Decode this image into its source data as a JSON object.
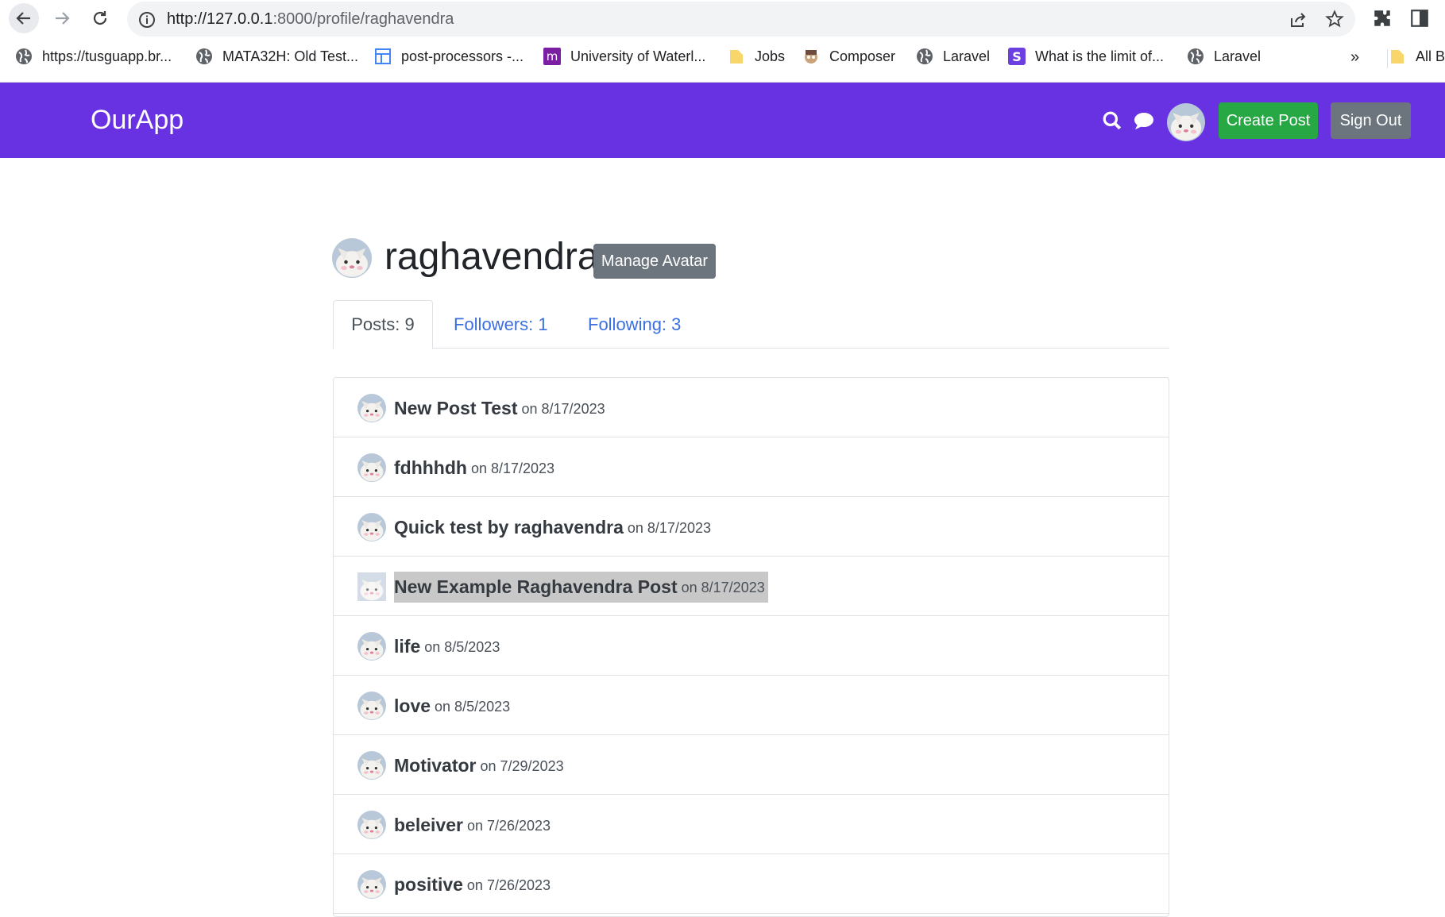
{
  "browser": {
    "url_host": "http://127.0.0.1",
    "url_rest": ":8000/profile/raghavendra",
    "bookmarks": [
      {
        "label": "https://tusguapp.br...",
        "icon": "globe-icon"
      },
      {
        "label": "MATA32H: Old Test...",
        "icon": "globe-icon"
      },
      {
        "label": "post-processors -...",
        "icon": "doc-icon"
      },
      {
        "label": "University of Waterl...",
        "icon": "m-icon"
      },
      {
        "label": "Jobs",
        "icon": "folder-icon"
      },
      {
        "label": "Composer",
        "icon": "composer-icon"
      },
      {
        "label": "Laravel",
        "icon": "globe-icon"
      },
      {
        "label": "What is the limit of...",
        "icon": "s-icon"
      },
      {
        "label": "Laravel",
        "icon": "globe-icon"
      }
    ],
    "more_label": "»",
    "all_bookmarks": "All B"
  },
  "header": {
    "brand": "OurApp",
    "create_label": "Create Post",
    "signout_label": "Sign Out",
    "bg_color": "#6831e2"
  },
  "profile": {
    "username": "raghavendra",
    "manage_label": "Manage Avatar",
    "tabs": [
      {
        "label": "Posts: 9"
      },
      {
        "label": "Followers: 1"
      },
      {
        "label": "Following: 3"
      }
    ]
  },
  "posts": [
    {
      "title": "New Post Test",
      "date": "on 8/17/2023"
    },
    {
      "title": "fdhhhdh",
      "date": "on 8/17/2023"
    },
    {
      "title": "Quick test by raghavendra",
      "date": "on 8/17/2023"
    },
    {
      "title": "New Example Raghavendra Post",
      "date": "on 8/17/2023"
    },
    {
      "title": "life",
      "date": "on 8/5/2023"
    },
    {
      "title": "love",
      "date": "on 8/5/2023"
    },
    {
      "title": "Motivator",
      "date": "on 7/29/2023"
    },
    {
      "title": "beleiver",
      "date": "on 7/26/2023"
    },
    {
      "title": "positive",
      "date": "on 7/26/2023"
    }
  ]
}
